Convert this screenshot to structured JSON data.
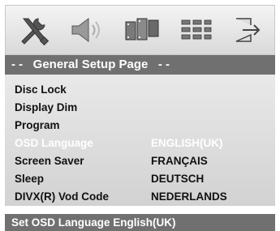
{
  "icons": [
    "tools-icon",
    "speaker-icon",
    "film-icon",
    "equalizer-icon",
    "exit-icon"
  ],
  "header": {
    "title": "- -   General Setup Page   - -"
  },
  "menu": {
    "items": [
      {
        "label": "Disc Lock"
      },
      {
        "label": "Display Dim"
      },
      {
        "label": "Program"
      },
      {
        "label": "OSD Language",
        "selected": true
      },
      {
        "label": "Screen Saver"
      },
      {
        "label": "Sleep"
      },
      {
        "label": "DIVX(R) Vod Code"
      }
    ]
  },
  "options": {
    "items": [
      {
        "label": "ENGLISH(UK)",
        "selected": true
      },
      {
        "label": "FRANÇAIS"
      },
      {
        "label": "DEUTSCH"
      },
      {
        "label": "NEDERLANDS"
      }
    ]
  },
  "status": {
    "text": "Set OSD Language English(UK)"
  }
}
